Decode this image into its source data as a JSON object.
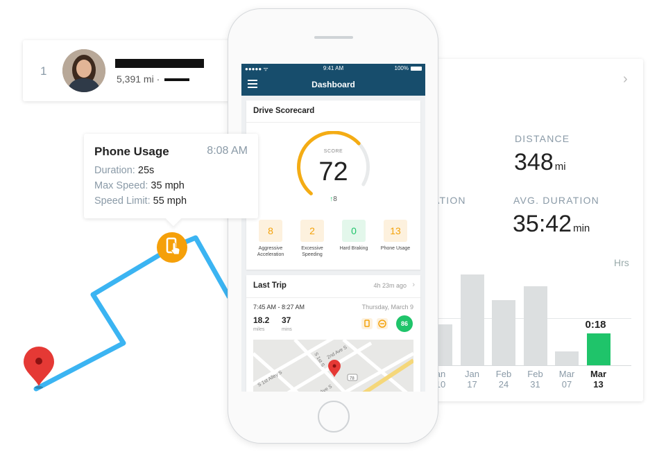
{
  "leaderboard": {
    "rank": "1",
    "distance_text": "5,391 mi ·"
  },
  "tooltip": {
    "title": "Phone Usage",
    "time": "8:08 AM",
    "rows": [
      {
        "label": "Duration:",
        "value": "25s"
      },
      {
        "label": "Max Speed:",
        "value": "35 mph"
      },
      {
        "label": "Speed Limit:",
        "value": "55 mph"
      }
    ]
  },
  "stats": {
    "distance_label": "DISTANCE",
    "distance_value": "348",
    "distance_unit": "mi",
    "duration_label_partial": "ATION",
    "avg_duration_label": "AVG. DURATION",
    "avg_duration_value": "35:42",
    "avg_duration_unit": "min",
    "chart_unit": "Hrs",
    "highlight_value": "0:18"
  },
  "chart_data": {
    "type": "bar",
    "categories": [
      [
        "an",
        "10"
      ],
      [
        "Jan",
        "17"
      ],
      [
        "Feb",
        "24"
      ],
      [
        "Feb",
        "31"
      ],
      [
        "Mar",
        "07"
      ],
      [
        "Mar",
        "13"
      ]
    ],
    "values": [
      0.45,
      1.0,
      0.72,
      0.87,
      0.15,
      0.35
    ],
    "highlight_index": 5,
    "ylabel": "Hrs"
  },
  "phone": {
    "status_left": "●●●●● ᯤ",
    "status_time": "9:41 AM",
    "status_battery": "100%",
    "nav_title": "Dashboard",
    "scorecard": {
      "title": "Drive Scorecard",
      "score_label": "SCORE",
      "score": "72",
      "delta": "8",
      "score_fraction": 0.72,
      "metrics": [
        {
          "value": "8",
          "label": "Aggressive Acceleration",
          "color": "orange"
        },
        {
          "value": "2",
          "label": "Excessive Speeding",
          "color": "orange"
        },
        {
          "value": "0",
          "label": "Hard Braking",
          "color": "green"
        },
        {
          "value": "13",
          "label": "Phone Usage",
          "color": "orange"
        }
      ]
    },
    "last_trip": {
      "title": "Last Trip",
      "ago": "4h 23m ago",
      "time_range": "7:45 AM - 8:27 AM",
      "date": "Thursday, March 9",
      "miles_value": "18.2",
      "miles_unit": "miles",
      "mins_value": "37",
      "mins_unit": "mins",
      "score": "86",
      "map_labels": [
        "S 1st Alley S",
        "2nd Ave S",
        "Ave S",
        "S 1st S",
        "78"
      ]
    }
  },
  "colors": {
    "route": "#3bb4f2",
    "orange": "#f4a20a",
    "green": "#1fc46a",
    "nav": "#174d6c",
    "pin": "#e53935"
  }
}
